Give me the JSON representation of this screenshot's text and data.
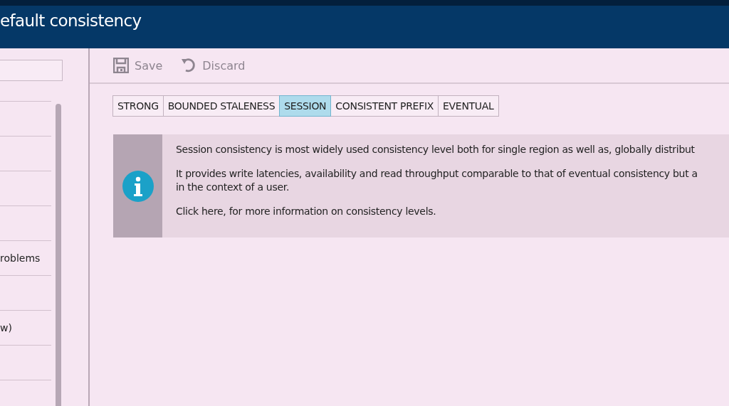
{
  "window": {
    "title": "efault consistency"
  },
  "sidebar": {
    "items": [
      {
        "kind": "blank"
      },
      {
        "kind": "blank"
      },
      {
        "kind": "blank"
      },
      {
        "kind": "blank"
      },
      {
        "kind": "text",
        "label": "roblems"
      },
      {
        "kind": "blank"
      },
      {
        "kind": "text",
        "label": "w)"
      },
      {
        "kind": "blank"
      },
      {
        "kind": "blank"
      }
    ]
  },
  "toolbar": {
    "buttons": [
      {
        "kind": "save",
        "label": "Save",
        "disabled": true
      },
      {
        "kind": "discard",
        "label": "Discard",
        "disabled": true
      }
    ]
  },
  "tabs": [
    {
      "label": "STRONG",
      "selected": false
    },
    {
      "label": "BOUNDED STALENESS",
      "selected": false
    },
    {
      "label": "SESSION",
      "selected": true
    },
    {
      "label": "CONSISTENT PREFIX",
      "selected": false
    },
    {
      "label": "EVENTUAL",
      "selected": false
    }
  ],
  "info": {
    "paragraphs": [
      "Session consistency is most widely used consistency level both for single region as well as, globally distribut",
      "It provides write latencies, availability and read throughput comparable to that of eventual consistency but a\nin the context of a user.",
      "Click here, for more information on consistency levels."
    ]
  }
}
